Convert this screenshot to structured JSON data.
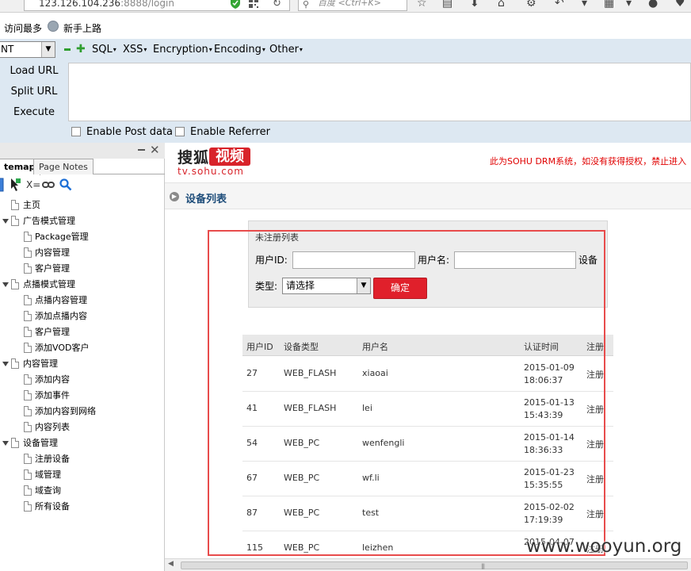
{
  "browser": {
    "url_host": "123.126.104.236",
    "url_rest": ":8888/login",
    "search_placeholder": "百度 <Ctrl+K>"
  },
  "bookmarks": [
    "访问最多",
    "新手上路"
  ],
  "hackbar": {
    "select_value": "NT",
    "menus": [
      "SQL",
      "XSS",
      "Encryption",
      "Encoding",
      "Other"
    ],
    "buttons": [
      "Load URL",
      "Split URL",
      "Execute"
    ],
    "checkboxes": [
      "Enable Post data",
      "Enable Referrer"
    ]
  },
  "sidebar": {
    "tabs": [
      "temap",
      "Page Notes"
    ],
    "tool_label": "X=",
    "tree": [
      {
        "label": "主页",
        "level": 0,
        "expandable": false
      },
      {
        "label": "广告模式管理",
        "level": 0,
        "expandable": true
      },
      {
        "label": "Package管理",
        "level": 1
      },
      {
        "label": "内容管理",
        "level": 1
      },
      {
        "label": "客户管理",
        "level": 1
      },
      {
        "label": "点播模式管理",
        "level": 0,
        "expandable": true
      },
      {
        "label": "点播内容管理",
        "level": 1
      },
      {
        "label": "添加点播内容",
        "level": 1
      },
      {
        "label": "客户管理",
        "level": 1
      },
      {
        "label": "添加VOD客户",
        "level": 1
      },
      {
        "label": "内容管理",
        "level": 0,
        "expandable": true
      },
      {
        "label": "添加内容",
        "level": 1
      },
      {
        "label": "添加事件",
        "level": 1
      },
      {
        "label": "添加内容到网络",
        "level": 1
      },
      {
        "label": "内容列表",
        "level": 1
      },
      {
        "label": "设备管理",
        "level": 0,
        "expandable": true
      },
      {
        "label": "注册设备",
        "level": 1
      },
      {
        "label": "域管理",
        "level": 1
      },
      {
        "label": "域查询",
        "level": 1
      },
      {
        "label": "所有设备",
        "level": 1
      }
    ]
  },
  "main": {
    "logo_text": "搜狐",
    "logo_badge": "视频",
    "logo_sub": "tv.sohu.com",
    "warning": "此为SOHU DRM系统，如没有获得授权，禁止进入",
    "page_title": "设备列表",
    "filter": {
      "legend": "未注册列表",
      "user_id_label": "用户ID:",
      "user_name_label": "用户名:",
      "device_label": "设备",
      "type_label": "类型:",
      "type_value": "请选择",
      "submit": "确定"
    },
    "table": {
      "headers": [
        "用户ID",
        "设备类型",
        "用户名",
        "认证时间",
        "注册"
      ],
      "rows": [
        {
          "id": "27",
          "type": "WEB_FLASH",
          "name": "xiaoai",
          "date": "2015-01-09",
          "time": "18:06:37",
          "reg": "注册"
        },
        {
          "id": "41",
          "type": "WEB_FLASH",
          "name": "lei",
          "date": "2015-01-13",
          "time": "15:43:39",
          "reg": "注册"
        },
        {
          "id": "54",
          "type": "WEB_PC",
          "name": "wenfengli",
          "date": "2015-01-14",
          "time": "18:36:33",
          "reg": "注册"
        },
        {
          "id": "67",
          "type": "WEB_PC",
          "name": "wf.li",
          "date": "2015-01-23",
          "time": "15:35:55",
          "reg": "注册"
        },
        {
          "id": "87",
          "type": "WEB_PC",
          "name": "test",
          "date": "2015-02-02",
          "time": "17:19:39",
          "reg": "注册"
        },
        {
          "id": "115",
          "type": "WEB_PC",
          "name": "leizhen",
          "date": "2015-04-07",
          "time": "",
          "reg": "注册"
        }
      ]
    }
  },
  "watermark": "www.wooyun.org",
  "colors": {
    "accent_red": "#e0202b",
    "hackbar_bg": "#dde8f2",
    "title_blue": "#1e4d7a",
    "frame_red": "#e84c4c"
  }
}
